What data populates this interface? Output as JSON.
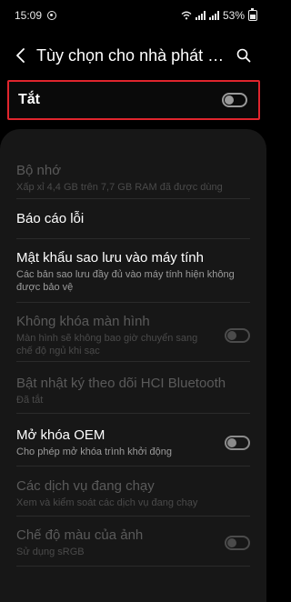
{
  "status": {
    "time": "15:09",
    "battery": "53%"
  },
  "header": {
    "title": "Tùy chọn cho nhà phát tri..."
  },
  "master_toggle": {
    "label": "Tắt",
    "state": "off"
  },
  "settings": [
    {
      "title": "Bộ nhớ",
      "subtitle": "Xấp xỉ 4,4 GB trên 7,7 GB RAM đã được dùng",
      "enabled": false,
      "toggle": null
    },
    {
      "title": "Báo cáo lỗi",
      "subtitle": "",
      "enabled": true,
      "toggle": null
    },
    {
      "title": "Mật khẩu sao lưu vào máy tính",
      "subtitle": "Các bản sao lưu đầy đủ vào máy tính hiện không được bảo vệ",
      "enabled": true,
      "toggle": null
    },
    {
      "title": "Không khóa màn hình",
      "subtitle": "Màn hình sẽ không bao giờ chuyển sang chế độ ngủ khi sạc",
      "enabled": false,
      "toggle": "off"
    },
    {
      "title": "Bật nhật ký theo dõi HCI Bluetooth",
      "subtitle": "Đã tắt",
      "enabled": false,
      "toggle": null
    },
    {
      "title": "Mở khóa OEM",
      "subtitle": "Cho phép mở khóa trình khởi động",
      "enabled": true,
      "toggle": "off"
    },
    {
      "title": "Các dịch vụ đang chạy",
      "subtitle": "Xem và kiểm soát các dịch vụ đang chạy",
      "enabled": false,
      "toggle": null
    },
    {
      "title": "Chế độ màu của ảnh",
      "subtitle": "Sử dụng sRGB",
      "enabled": false,
      "toggle": "off"
    }
  ],
  "colors": {
    "background": "#000000",
    "card": "#171717",
    "highlight_border": "#e0252d",
    "disabled_text": "#5a5a5a"
  }
}
